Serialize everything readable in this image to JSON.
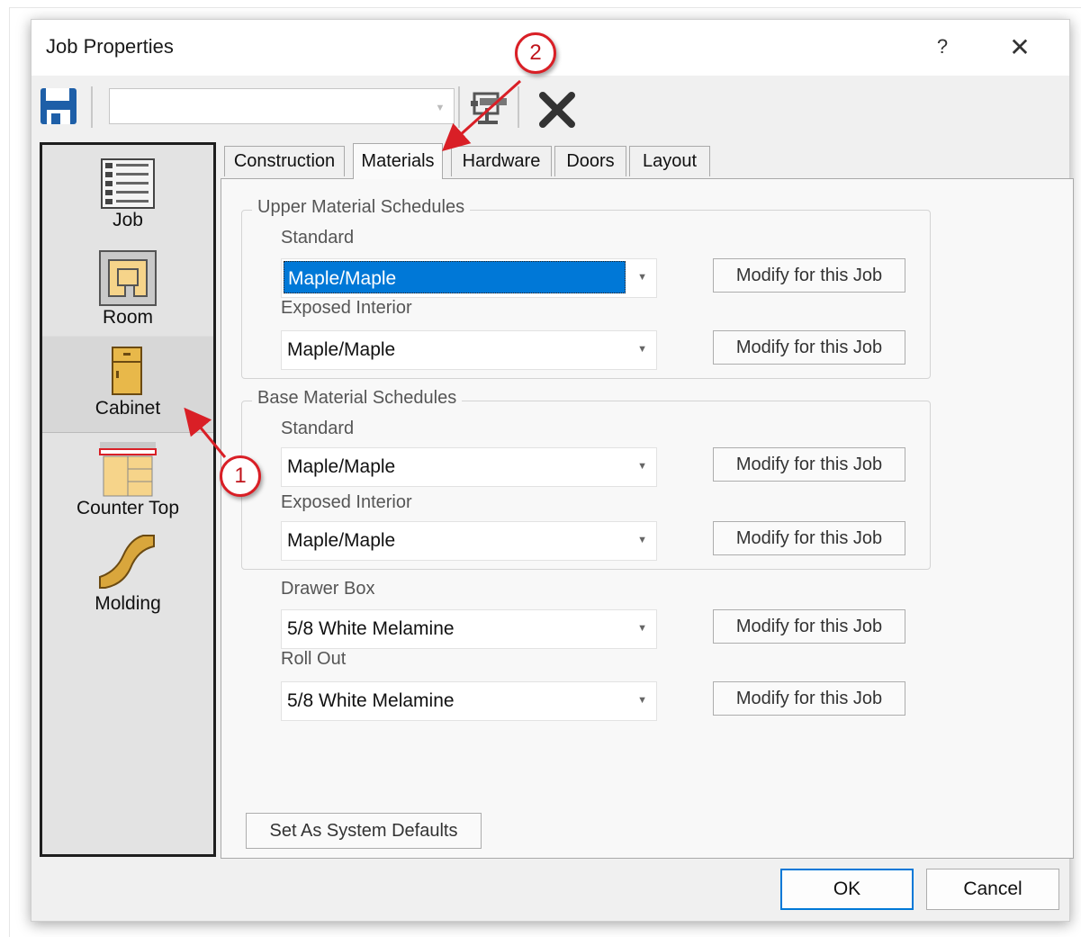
{
  "window": {
    "title": "Job Properties",
    "help_label": "?",
    "close_label": "✕"
  },
  "toolbar": {
    "job_select_value": "",
    "icons": [
      "save-icon",
      "layout-icon",
      "delete-icon"
    ]
  },
  "sidebar": {
    "items": [
      {
        "label": "Job",
        "icon": "job-icon"
      },
      {
        "label": "Room",
        "icon": "room-icon"
      },
      {
        "label": "Cabinet",
        "icon": "cabinet-icon",
        "selected": true
      },
      {
        "label": "Counter Top",
        "icon": "countertop-icon"
      },
      {
        "label": "Molding",
        "icon": "molding-icon"
      }
    ]
  },
  "tabs": [
    {
      "label": "Construction"
    },
    {
      "label": "Materials",
      "active": true
    },
    {
      "label": "Hardware"
    },
    {
      "label": "Doors"
    },
    {
      "label": "Layout"
    }
  ],
  "materials": {
    "upper": {
      "legend": "Upper Material Schedules",
      "standard_label": "Standard",
      "standard_value": "Maple/Maple",
      "exposed_label": "Exposed Interior",
      "exposed_value": "Maple/Maple"
    },
    "base": {
      "legend": "Base Material Schedules",
      "standard_label": "Standard",
      "standard_value": "Maple/Maple",
      "exposed_label": "Exposed Interior",
      "exposed_value": "Maple/Maple"
    },
    "drawer_box_label": "Drawer Box",
    "drawer_box_value": "5/8 White Melamine",
    "roll_out_label": "Roll Out",
    "roll_out_value": "5/8 White Melamine",
    "modify_label": "Modify for this Job"
  },
  "footer": {
    "defaults_label": "Set As System Defaults",
    "ok_label": "OK",
    "cancel_label": "Cancel"
  },
  "annotations": {
    "callout_1": "1",
    "callout_2": "2",
    "accent": "#d91f26"
  },
  "colors": {
    "selection": "#0078d7",
    "save_icon": "#1e5fa8",
    "wood": "#e8b84a"
  }
}
